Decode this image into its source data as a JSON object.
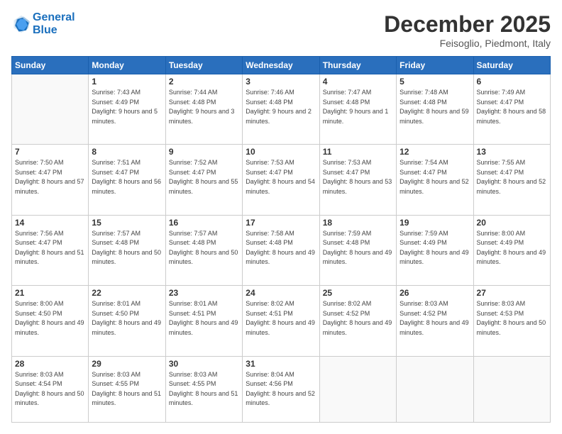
{
  "header": {
    "logo_line1": "General",
    "logo_line2": "Blue",
    "month_title": "December 2025",
    "location": "Feisoglio, Piedmont, Italy"
  },
  "weekdays": [
    "Sunday",
    "Monday",
    "Tuesday",
    "Wednesday",
    "Thursday",
    "Friday",
    "Saturday"
  ],
  "weeks": [
    [
      {
        "day": "",
        "sunrise": "",
        "sunset": "",
        "daylight": ""
      },
      {
        "day": "1",
        "sunrise": "Sunrise: 7:43 AM",
        "sunset": "Sunset: 4:49 PM",
        "daylight": "Daylight: 9 hours and 5 minutes."
      },
      {
        "day": "2",
        "sunrise": "Sunrise: 7:44 AM",
        "sunset": "Sunset: 4:48 PM",
        "daylight": "Daylight: 9 hours and 3 minutes."
      },
      {
        "day": "3",
        "sunrise": "Sunrise: 7:46 AM",
        "sunset": "Sunset: 4:48 PM",
        "daylight": "Daylight: 9 hours and 2 minutes."
      },
      {
        "day": "4",
        "sunrise": "Sunrise: 7:47 AM",
        "sunset": "Sunset: 4:48 PM",
        "daylight": "Daylight: 9 hours and 1 minute."
      },
      {
        "day": "5",
        "sunrise": "Sunrise: 7:48 AM",
        "sunset": "Sunset: 4:48 PM",
        "daylight": "Daylight: 8 hours and 59 minutes."
      },
      {
        "day": "6",
        "sunrise": "Sunrise: 7:49 AM",
        "sunset": "Sunset: 4:47 PM",
        "daylight": "Daylight: 8 hours and 58 minutes."
      }
    ],
    [
      {
        "day": "7",
        "sunrise": "Sunrise: 7:50 AM",
        "sunset": "Sunset: 4:47 PM",
        "daylight": "Daylight: 8 hours and 57 minutes."
      },
      {
        "day": "8",
        "sunrise": "Sunrise: 7:51 AM",
        "sunset": "Sunset: 4:47 PM",
        "daylight": "Daylight: 8 hours and 56 minutes."
      },
      {
        "day": "9",
        "sunrise": "Sunrise: 7:52 AM",
        "sunset": "Sunset: 4:47 PM",
        "daylight": "Daylight: 8 hours and 55 minutes."
      },
      {
        "day": "10",
        "sunrise": "Sunrise: 7:53 AM",
        "sunset": "Sunset: 4:47 PM",
        "daylight": "Daylight: 8 hours and 54 minutes."
      },
      {
        "day": "11",
        "sunrise": "Sunrise: 7:53 AM",
        "sunset": "Sunset: 4:47 PM",
        "daylight": "Daylight: 8 hours and 53 minutes."
      },
      {
        "day": "12",
        "sunrise": "Sunrise: 7:54 AM",
        "sunset": "Sunset: 4:47 PM",
        "daylight": "Daylight: 8 hours and 52 minutes."
      },
      {
        "day": "13",
        "sunrise": "Sunrise: 7:55 AM",
        "sunset": "Sunset: 4:47 PM",
        "daylight": "Daylight: 8 hours and 52 minutes."
      }
    ],
    [
      {
        "day": "14",
        "sunrise": "Sunrise: 7:56 AM",
        "sunset": "Sunset: 4:47 PM",
        "daylight": "Daylight: 8 hours and 51 minutes."
      },
      {
        "day": "15",
        "sunrise": "Sunrise: 7:57 AM",
        "sunset": "Sunset: 4:48 PM",
        "daylight": "Daylight: 8 hours and 50 minutes."
      },
      {
        "day": "16",
        "sunrise": "Sunrise: 7:57 AM",
        "sunset": "Sunset: 4:48 PM",
        "daylight": "Daylight: 8 hours and 50 minutes."
      },
      {
        "day": "17",
        "sunrise": "Sunrise: 7:58 AM",
        "sunset": "Sunset: 4:48 PM",
        "daylight": "Daylight: 8 hours and 49 minutes."
      },
      {
        "day": "18",
        "sunrise": "Sunrise: 7:59 AM",
        "sunset": "Sunset: 4:48 PM",
        "daylight": "Daylight: 8 hours and 49 minutes."
      },
      {
        "day": "19",
        "sunrise": "Sunrise: 7:59 AM",
        "sunset": "Sunset: 4:49 PM",
        "daylight": "Daylight: 8 hours and 49 minutes."
      },
      {
        "day": "20",
        "sunrise": "Sunrise: 8:00 AM",
        "sunset": "Sunset: 4:49 PM",
        "daylight": "Daylight: 8 hours and 49 minutes."
      }
    ],
    [
      {
        "day": "21",
        "sunrise": "Sunrise: 8:00 AM",
        "sunset": "Sunset: 4:50 PM",
        "daylight": "Daylight: 8 hours and 49 minutes."
      },
      {
        "day": "22",
        "sunrise": "Sunrise: 8:01 AM",
        "sunset": "Sunset: 4:50 PM",
        "daylight": "Daylight: 8 hours and 49 minutes."
      },
      {
        "day": "23",
        "sunrise": "Sunrise: 8:01 AM",
        "sunset": "Sunset: 4:51 PM",
        "daylight": "Daylight: 8 hours and 49 minutes."
      },
      {
        "day": "24",
        "sunrise": "Sunrise: 8:02 AM",
        "sunset": "Sunset: 4:51 PM",
        "daylight": "Daylight: 8 hours and 49 minutes."
      },
      {
        "day": "25",
        "sunrise": "Sunrise: 8:02 AM",
        "sunset": "Sunset: 4:52 PM",
        "daylight": "Daylight: 8 hours and 49 minutes."
      },
      {
        "day": "26",
        "sunrise": "Sunrise: 8:03 AM",
        "sunset": "Sunset: 4:52 PM",
        "daylight": "Daylight: 8 hours and 49 minutes."
      },
      {
        "day": "27",
        "sunrise": "Sunrise: 8:03 AM",
        "sunset": "Sunset: 4:53 PM",
        "daylight": "Daylight: 8 hours and 50 minutes."
      }
    ],
    [
      {
        "day": "28",
        "sunrise": "Sunrise: 8:03 AM",
        "sunset": "Sunset: 4:54 PM",
        "daylight": "Daylight: 8 hours and 50 minutes."
      },
      {
        "day": "29",
        "sunrise": "Sunrise: 8:03 AM",
        "sunset": "Sunset: 4:55 PM",
        "daylight": "Daylight: 8 hours and 51 minutes."
      },
      {
        "day": "30",
        "sunrise": "Sunrise: 8:03 AM",
        "sunset": "Sunset: 4:55 PM",
        "daylight": "Daylight: 8 hours and 51 minutes."
      },
      {
        "day": "31",
        "sunrise": "Sunrise: 8:04 AM",
        "sunset": "Sunset: 4:56 PM",
        "daylight": "Daylight: 8 hours and 52 minutes."
      },
      {
        "day": "",
        "sunrise": "",
        "sunset": "",
        "daylight": ""
      },
      {
        "day": "",
        "sunrise": "",
        "sunset": "",
        "daylight": ""
      },
      {
        "day": "",
        "sunrise": "",
        "sunset": "",
        "daylight": ""
      }
    ]
  ]
}
